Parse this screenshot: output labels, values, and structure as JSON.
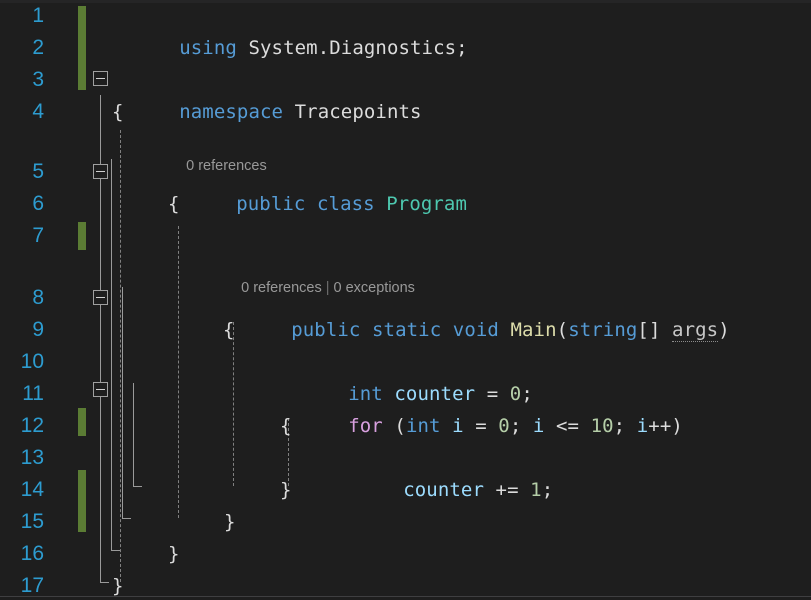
{
  "editor": {
    "language": "csharp",
    "theme": "dark",
    "background_color": "#1e1e1e",
    "line_number_color": "#2d9cd0",
    "change_bar_color": "#5b7c34",
    "font_size_px": 19,
    "line_height_px": 32,
    "total_lines": 17
  },
  "line_numbers": [
    "1",
    "2",
    "3",
    "4",
    "5",
    "6",
    "7",
    "8",
    "9",
    "10",
    "11",
    "12",
    "13",
    "14",
    "15",
    "16",
    "17"
  ],
  "codelens": {
    "class_program": {
      "references": "0 references"
    },
    "method_main": {
      "references": "0 references",
      "separator": "|",
      "exceptions": "0 exceptions"
    }
  },
  "code_lines": [
    {
      "n": "1",
      "text": "using System.Diagnostics;"
    },
    {
      "n": "2",
      "text": ""
    },
    {
      "n": "3",
      "text": "namespace Tracepoints"
    },
    {
      "n": "4",
      "text": "{"
    },
    {
      "n": "5",
      "text": "    public class Program"
    },
    {
      "n": "6",
      "text": "    {"
    },
    {
      "n": "7",
      "text": ""
    },
    {
      "n": "8",
      "text": "        public static void Main(string[] args)"
    },
    {
      "n": "9",
      "text": "        {"
    },
    {
      "n": "10",
      "text": "            int counter = 0;"
    },
    {
      "n": "11",
      "text": "            for (int i = 0; i <= 10; i++)"
    },
    {
      "n": "12",
      "text": "            {"
    },
    {
      "n": "13",
      "text": "                counter += 1;"
    },
    {
      "n": "14",
      "text": "            }"
    },
    {
      "n": "15",
      "text": "        }"
    },
    {
      "n": "16",
      "text": "    }"
    },
    {
      "n": "17",
      "text": "}"
    }
  ],
  "tokens": {
    "l1_using": "using",
    "l1_ns": " System.Diagnostics;",
    "l3_namespace": "namespace",
    "l3_name": " Tracepoints",
    "l4_brace": "{",
    "l5_mod": "public class",
    "l5_type": " Program",
    "l6_brace": "{",
    "l8_mod": "public static void",
    "l8_method": " Main",
    "l8_open": "(",
    "l8_string": "string",
    "l8_brackets": "[] ",
    "l8_args": "args",
    "l8_close": ")",
    "l9_brace": "{",
    "l10_int": "int",
    "l10_var": " counter ",
    "l10_eq": "= ",
    "l10_zero": "0",
    "l10_semi": ";",
    "l11_for": "for",
    "l11_paren1": " (",
    "l11_int": "int",
    "l11_i1": " i ",
    "l11_eq": "= ",
    "l11_zero": "0",
    "l11_semi1": "; ",
    "l11_i2": "i",
    "l11_cmp": " <= ",
    "l11_ten": "10",
    "l11_semi2": "; ",
    "l11_i3": "i",
    "l11_inc": "++",
    "l11_paren2": ")",
    "l12_brace": "{",
    "l13_var": "counter",
    "l13_op": " += ",
    "l13_one": "1",
    "l13_semi": ";",
    "l14_brace": "}",
    "l15_brace": "}",
    "l16_brace": "}",
    "l17_brace": "}"
  },
  "fold_markers": {
    "lines": [
      "3",
      "5",
      "8",
      "11"
    ],
    "glyph": "minus-square"
  },
  "change_bars": {
    "segments": [
      {
        "start_line": "1",
        "end_line": "3"
      },
      {
        "start_line": "7",
        "end_line": "7"
      },
      {
        "start_line": "12",
        "end_line": "12"
      },
      {
        "start_line": "14",
        "end_line": "15"
      }
    ]
  }
}
